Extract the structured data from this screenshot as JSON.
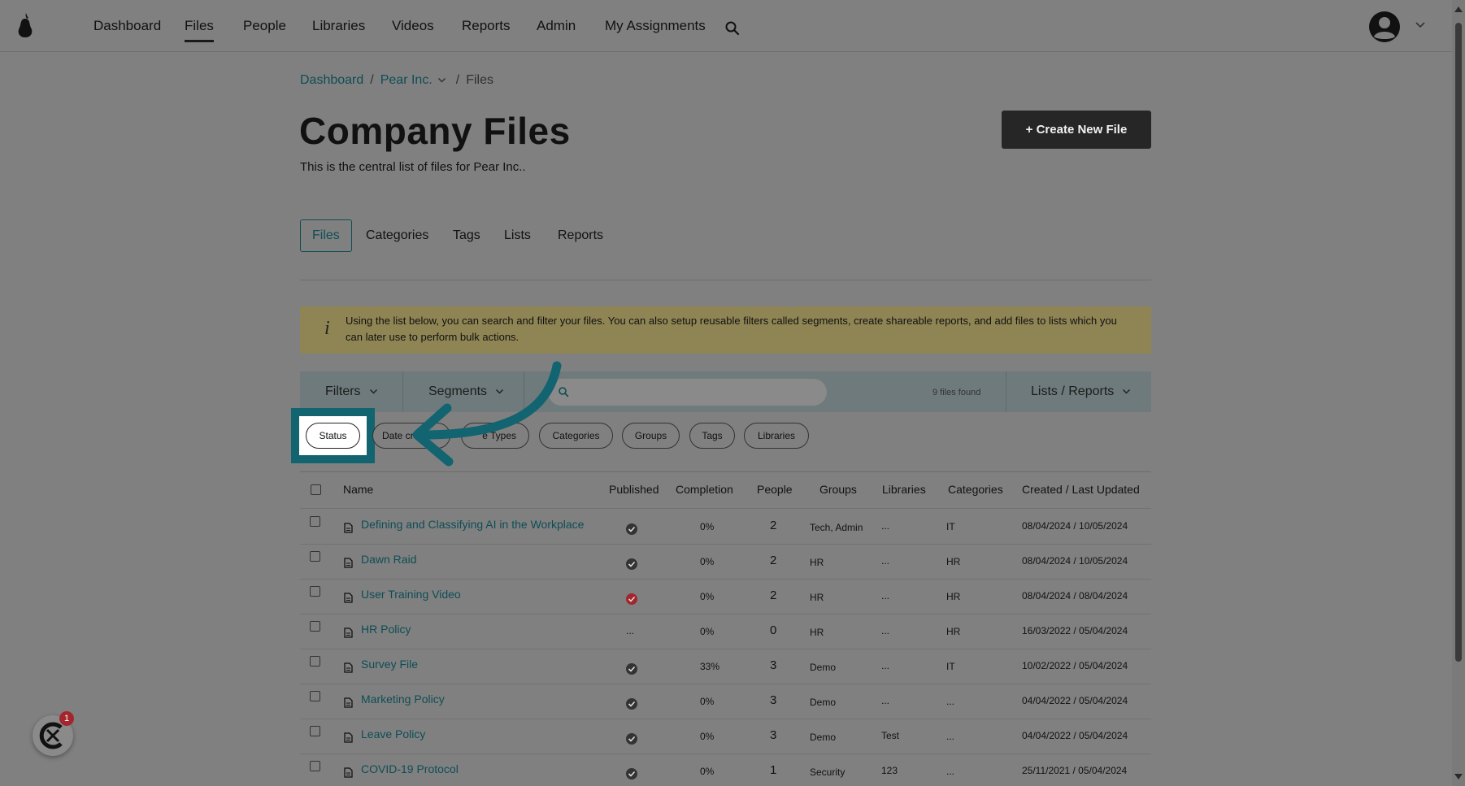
{
  "nav": {
    "items": [
      {
        "label": "Dashboard",
        "active": false
      },
      {
        "label": "Files",
        "active": true
      },
      {
        "label": "People",
        "active": false
      },
      {
        "label": "Libraries",
        "active": false
      },
      {
        "label": "Videos",
        "active": false
      },
      {
        "label": "Reports",
        "active": false
      },
      {
        "label": "Admin",
        "active": false
      },
      {
        "label": "My Assignments",
        "active": false
      }
    ]
  },
  "breadcrumb": {
    "root": "Dashboard",
    "company": "Pear Inc.",
    "current": "Files"
  },
  "page": {
    "title": "Company Files",
    "description": "This is the central list of files for Pear Inc..",
    "create_button": "+ Create New File"
  },
  "subtabs": [
    "Files",
    "Categories",
    "Tags",
    "Lists",
    "Reports"
  ],
  "info": {
    "icon": "i",
    "text": "Using the list below, you can search and filter your files. You can also setup reusable filters called segments, create shareable reports, and add files to lists which you can later use to perform bulk actions."
  },
  "toolbar": {
    "filters": "Filters",
    "segments": "Segments",
    "search_placeholder": "",
    "files_found": "9 files found",
    "lists_reports": "Lists / Reports"
  },
  "filter_pills": [
    "Status",
    "Date cr",
    "e Types",
    "Categories",
    "Groups",
    "Tags",
    "Libraries"
  ],
  "table": {
    "columns": [
      "Name",
      "Published",
      "Completion",
      "People",
      "Groups",
      "Libraries",
      "Categories",
      "Created / Last Updated"
    ],
    "rows": [
      {
        "name": "Defining and Classifying AI in the Workplace",
        "published": "check",
        "completion": "0%",
        "people": "2",
        "groups": "Tech, Admin",
        "libraries": "...",
        "categories": "IT",
        "dates": "08/04/2024 / 10/05/2024"
      },
      {
        "name": "Dawn Raid",
        "published": "check",
        "completion": "0%",
        "people": "2",
        "groups": "HR",
        "libraries": "...",
        "categories": "HR",
        "dates": "08/04/2024 / 10/05/2024"
      },
      {
        "name": "User Training Video",
        "published": "check-red",
        "completion": "0%",
        "people": "2",
        "groups": "HR",
        "libraries": "...",
        "categories": "HR",
        "dates": "08/04/2024 / 08/04/2024"
      },
      {
        "name": "HR Policy",
        "published": "...",
        "completion": "0%",
        "people": "0",
        "groups": "HR",
        "libraries": "...",
        "categories": "HR",
        "dates": "16/03/2022 / 05/04/2024"
      },
      {
        "name": "Survey File",
        "published": "check",
        "completion": "33%",
        "people": "3",
        "groups": "Demo",
        "libraries": "...",
        "categories": "IT",
        "dates": "10/02/2022 / 05/04/2024"
      },
      {
        "name": "Marketing Policy",
        "published": "check",
        "completion": "0%",
        "people": "3",
        "groups": "Demo",
        "libraries": "...",
        "categories": "...",
        "dates": "04/04/2022 / 05/04/2024"
      },
      {
        "name": "Leave Policy",
        "published": "check",
        "completion": "0%",
        "people": "3",
        "groups": "Demo",
        "libraries": "Test",
        "categories": "...",
        "dates": "04/04/2022 / 05/04/2024"
      },
      {
        "name": "COVID-19 Protocol",
        "published": "check",
        "completion": "0%",
        "people": "1",
        "groups": "Security",
        "libraries": "123",
        "categories": "...",
        "dates": "25/11/2021 / 05/04/2024"
      }
    ]
  },
  "chat": {
    "badge": "1"
  },
  "colors": {
    "accent": "#0e4d55",
    "highlight": "#126470",
    "danger": "#a3262e",
    "banner": "#8f8554"
  }
}
